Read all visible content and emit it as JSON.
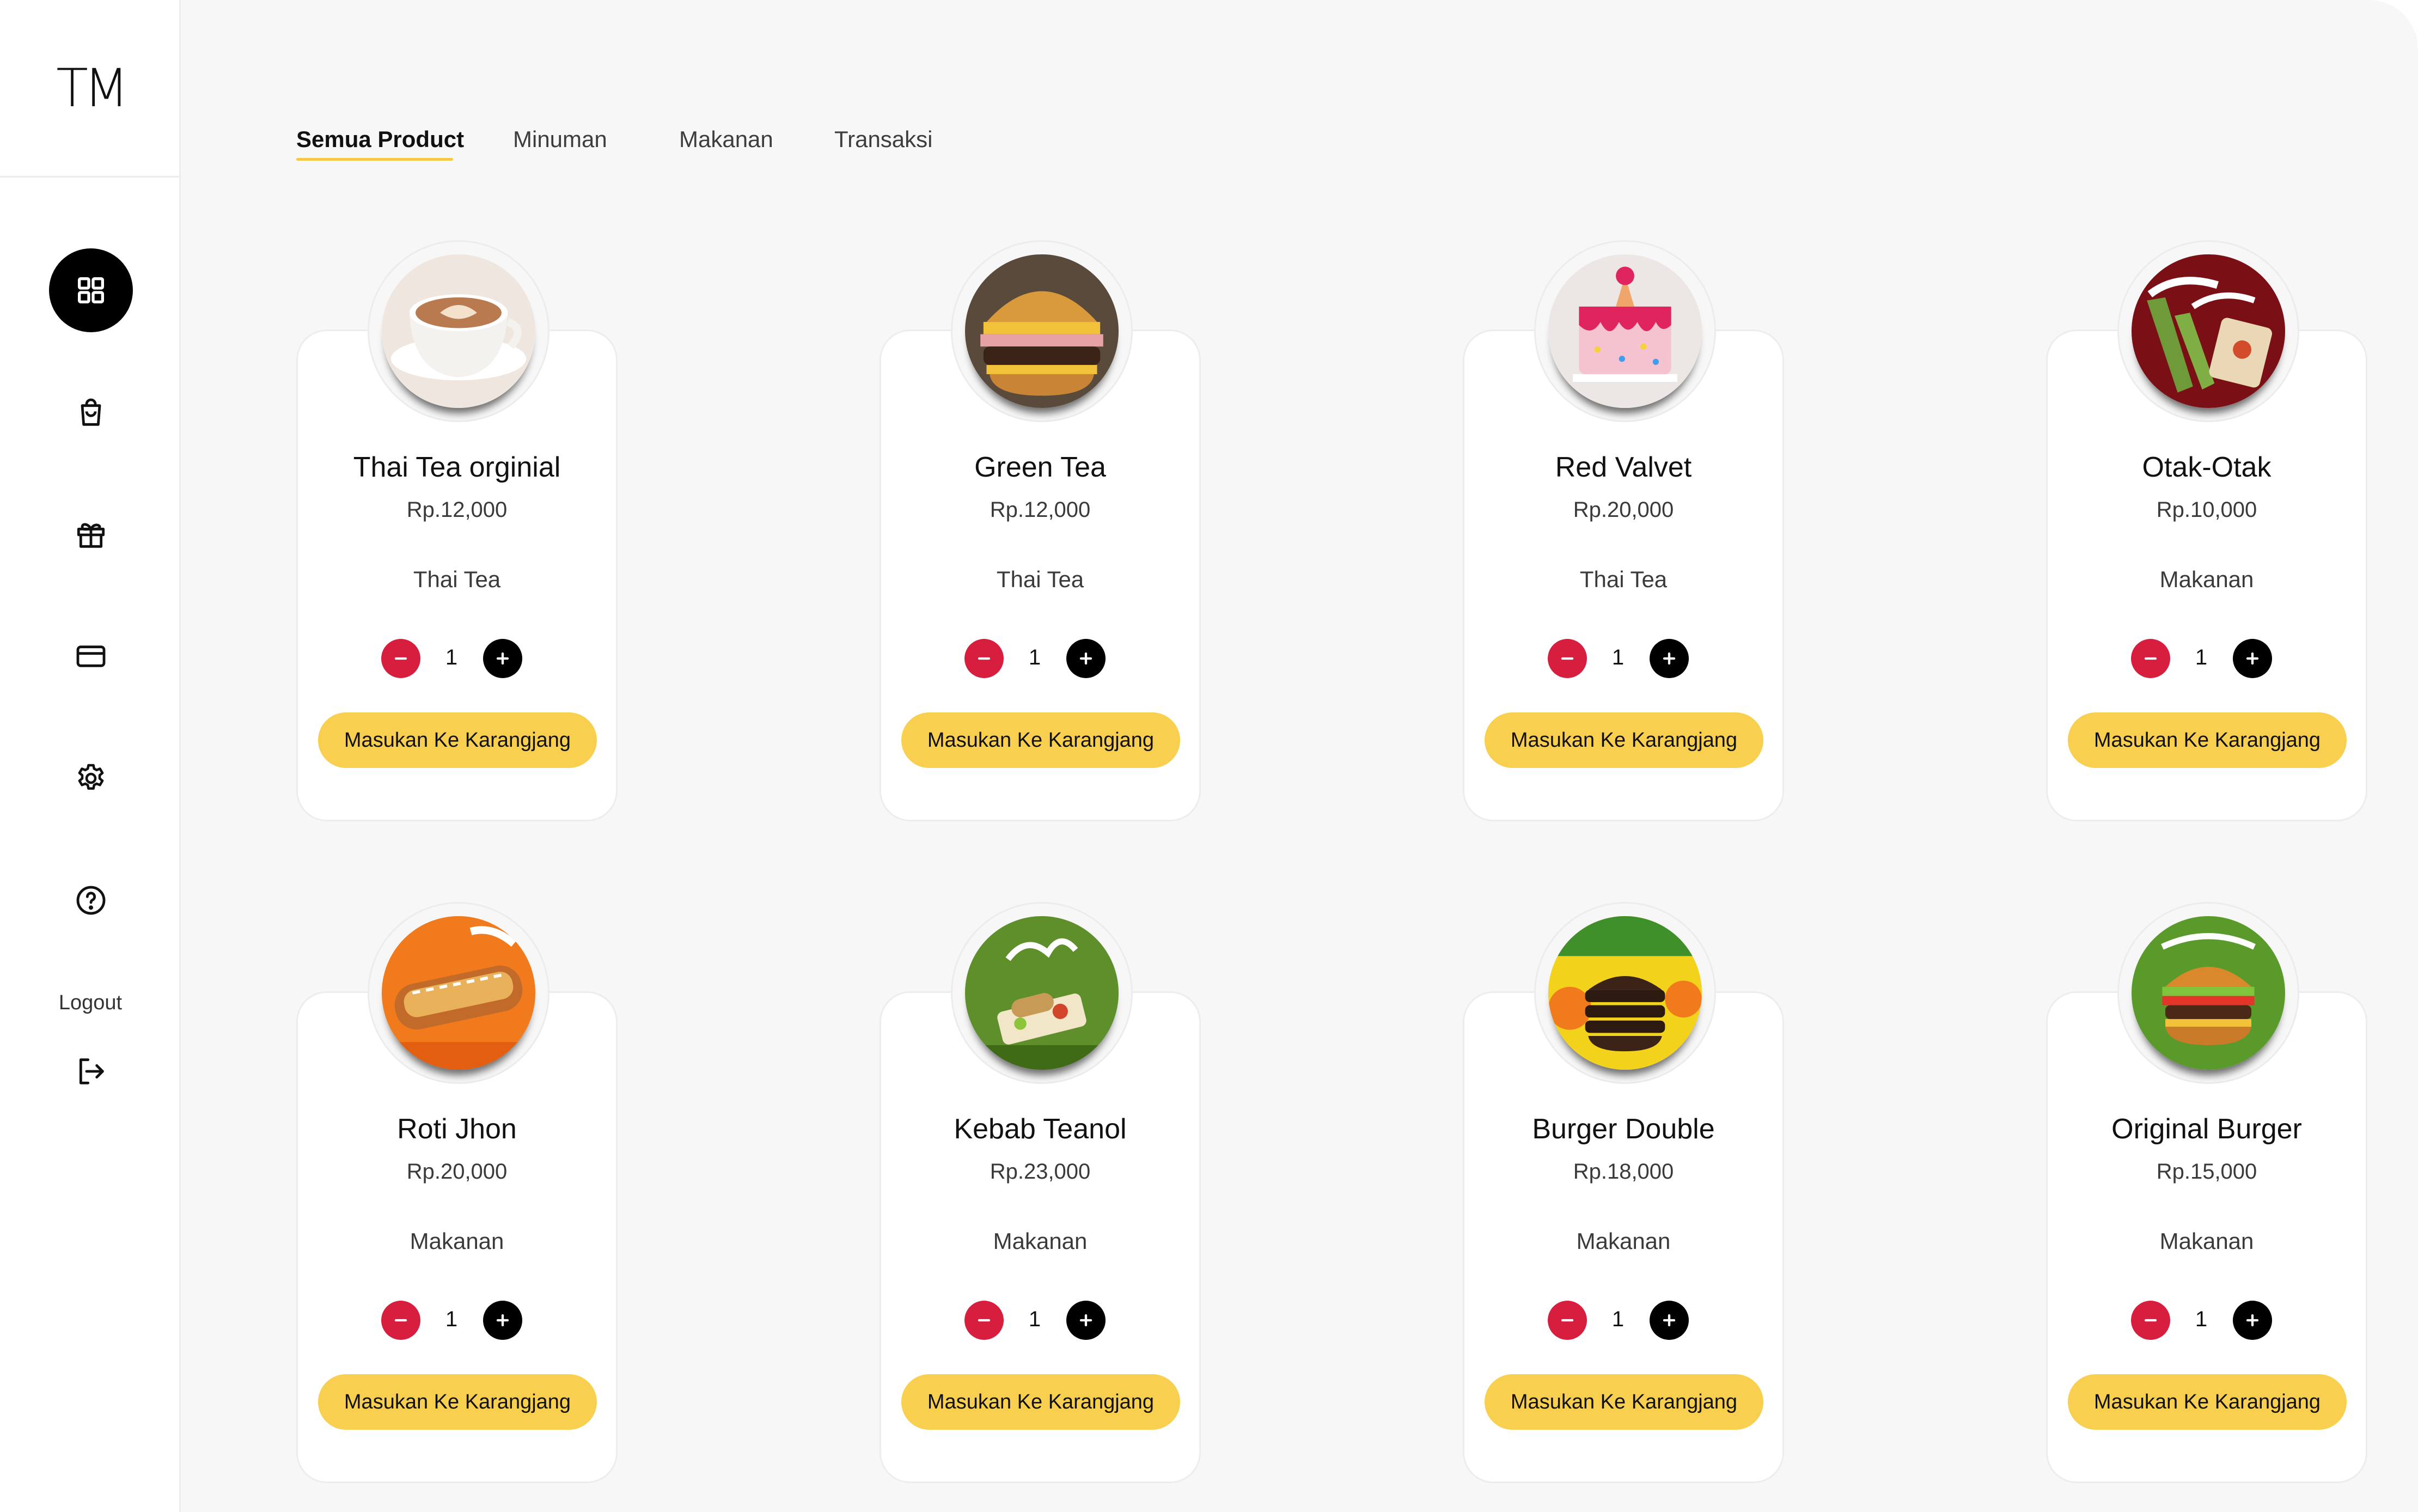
{
  "logo": {
    "text": "TM"
  },
  "sidebar": {
    "items": [
      {
        "name": "dashboard",
        "icon": "grid-icon",
        "active": true
      },
      {
        "name": "orders",
        "icon": "shopping-bag-icon"
      },
      {
        "name": "promotions",
        "icon": "gift-icon"
      },
      {
        "name": "payments",
        "icon": "credit-card-icon"
      },
      {
        "name": "settings",
        "icon": "gear-icon"
      },
      {
        "name": "help",
        "icon": "help-circle-icon"
      }
    ],
    "logout_label": "Logout",
    "logout_icon": "logout-icon"
  },
  "tabs": [
    {
      "label": "Semua Product",
      "active": true
    },
    {
      "label": "Minuman"
    },
    {
      "label": "Makanan"
    },
    {
      "label": "Transaksi"
    }
  ],
  "colors": {
    "accent_yellow": "#f8cf4f",
    "minus_red": "#d81e3f",
    "plus_black": "#000000",
    "main_bg": "#f7f7f7"
  },
  "products": [
    {
      "name": "Thai Tea orginial",
      "price": "Rp.12,000",
      "category": "Thai Tea",
      "qty": "1",
      "button": "Masukan Ke Karangjang",
      "image": "coffee-cup"
    },
    {
      "name": "Green Tea",
      "price": "Rp.12,000",
      "category": "Thai Tea",
      "qty": "1",
      "button": "Masukan Ke Karangjang",
      "image": "burger"
    },
    {
      "name": "Red Valvet",
      "price": "Rp.20,000",
      "category": "Thai Tea",
      "qty": "1",
      "button": "Masukan Ke Karangjang",
      "image": "cake"
    },
    {
      "name": "Otak-Otak",
      "price": "Rp.10,000",
      "category": "Makanan",
      "qty": "1",
      "button": "Masukan Ke Karangjang",
      "image": "otak-otak"
    },
    {
      "name": "Roti Jhon",
      "price": "Rp.20,000",
      "category": "Makanan",
      "qty": "1",
      "button": "Masukan Ke Karangjang",
      "image": "roti-jhon"
    },
    {
      "name": "Kebab Teanol",
      "price": "Rp.23,000",
      "category": "Makanan",
      "qty": "1",
      "button": "Masukan Ke Karangjang",
      "image": "kebab"
    },
    {
      "name": "Burger Double",
      "price": "Rp.18,000",
      "category": "Makanan",
      "qty": "1",
      "button": "Masukan Ke Karangjang",
      "image": "burger-double"
    },
    {
      "name": "Original Burger",
      "price": "Rp.15,000",
      "category": "Makanan",
      "qty": "1",
      "button": "Masukan Ke Karangjang",
      "image": "original-burger"
    }
  ]
}
